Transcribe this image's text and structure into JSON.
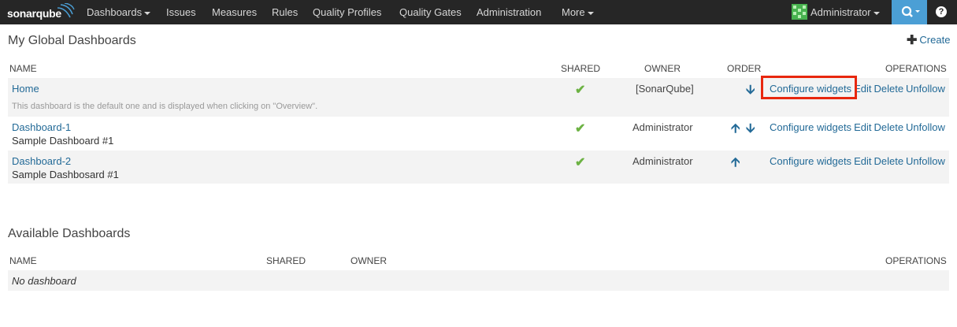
{
  "nav": {
    "logo": "sonarqube",
    "items": [
      "Dashboards",
      "Issues",
      "Measures",
      "Rules",
      "Quality Profiles",
      "Quality Gates",
      "Administration",
      "More"
    ],
    "user": "Administrator"
  },
  "global": {
    "title": "My Global Dashboards",
    "create_label": "Create",
    "headers": {
      "name": "NAME",
      "shared": "SHARED",
      "owner": "OWNER",
      "order": "ORDER",
      "operations": "OPERATIONS"
    },
    "rows": [
      {
        "name": "Home",
        "description": "This dashboard is the default one and is displayed when clicking on \"Overview\".",
        "owner": "[SonarQube]"
      },
      {
        "name": "Dashboard-1",
        "description": "Sample Dashboard #1",
        "owner": "Administrator"
      },
      {
        "name": "Dashboard-2",
        "description": "Sample Dashbosard #1",
        "owner": "Administrator"
      }
    ],
    "operations": {
      "configure": "Configure widgets",
      "edit": "Edit",
      "delete": "Delete",
      "unfollow": "Unfollow"
    }
  },
  "available": {
    "title": "Available Dashboards",
    "headers": {
      "name": "NAME",
      "shared": "SHARED",
      "owner": "OWNER",
      "operations": "OPERATIONS"
    },
    "empty": "No dashboard"
  },
  "colors": {
    "navbar": "#262626",
    "link": "#236a97",
    "check": "#6cb243",
    "highlight": "#e8270e",
    "search": "#4b9fd5"
  }
}
